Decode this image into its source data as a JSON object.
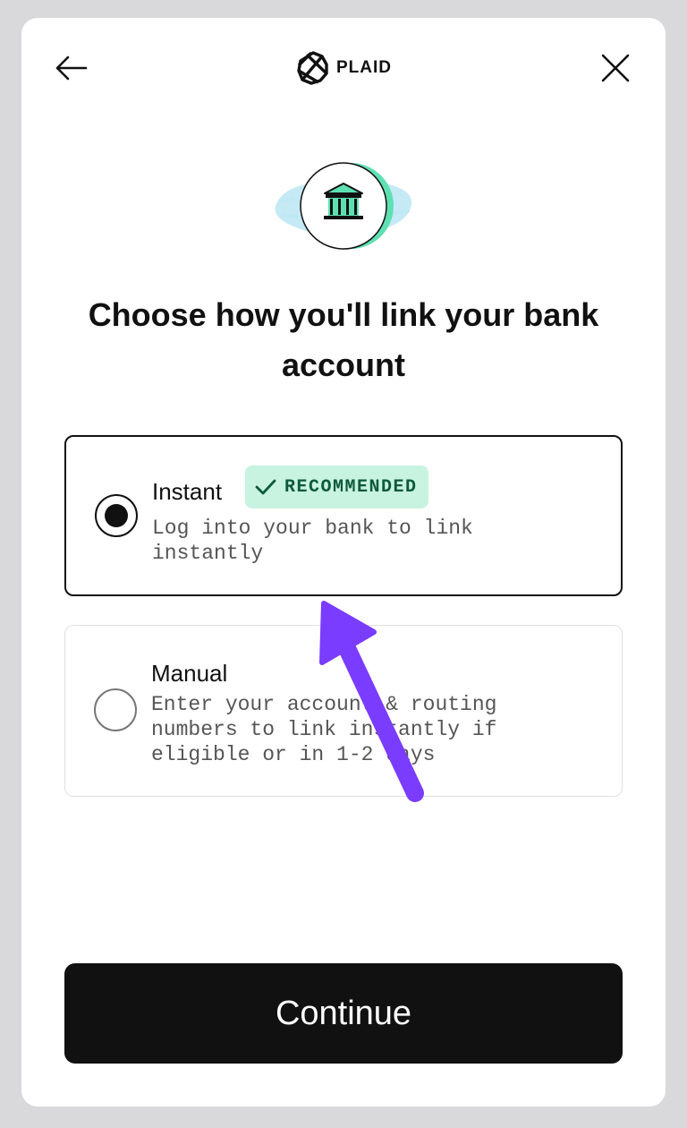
{
  "header": {
    "back_icon": "arrow-left-icon",
    "close_icon": "close-icon",
    "logo_text": "PLAID"
  },
  "hero": {
    "icon": "bank-icon"
  },
  "title": "Choose how you'll link your bank account",
  "options": [
    {
      "title": "Instant",
      "badge": "RECOMMENDED",
      "description": "Log into your bank to link instantly",
      "selected": true
    },
    {
      "title": "Manual",
      "description": "Enter your account & routing numbers to link instantly if eligible or in 1-2 days",
      "selected": false
    }
  ],
  "continue_label": "Continue",
  "colors": {
    "primary": "#111111",
    "badge_bg": "#c8f3e0",
    "badge_text": "#0d5a3c",
    "accent_green": "#5fe0b2",
    "annotation": "#7a3cff"
  }
}
